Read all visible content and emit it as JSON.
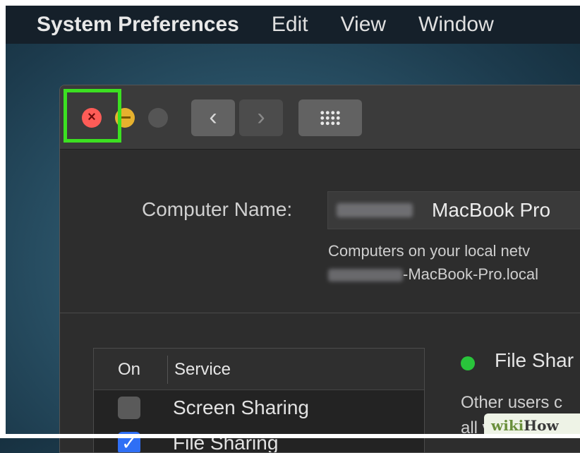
{
  "menubar": {
    "app_name": "System Preferences",
    "items": [
      "Edit",
      "View",
      "Window"
    ]
  },
  "window": {
    "nav": {
      "back_glyph": "‹",
      "forward_glyph": "›"
    },
    "computer_name": {
      "label": "Computer Name:",
      "value": "MacBook Pro",
      "description": "Computers on your local netv",
      "hostname": "-MacBook-Pro.local"
    },
    "services_table": {
      "col_on": "On",
      "col_service": "Service",
      "rows": [
        {
          "label": "Screen Sharing",
          "checked": false
        },
        {
          "label": "File Sharing",
          "checked": true
        }
      ]
    },
    "status": {
      "title": "File Shar",
      "desc_line1": "Other users c",
      "desc_line2": "all volumes, a",
      "color": "#29c43b"
    }
  },
  "watermark": {
    "prefix": "wiki",
    "suffix": "How"
  },
  "colors": {
    "highlight": "#3ce021",
    "close": "#fe5c57",
    "minimize": "#e6b12e",
    "checkbox_checked": "#2f6ff5"
  }
}
